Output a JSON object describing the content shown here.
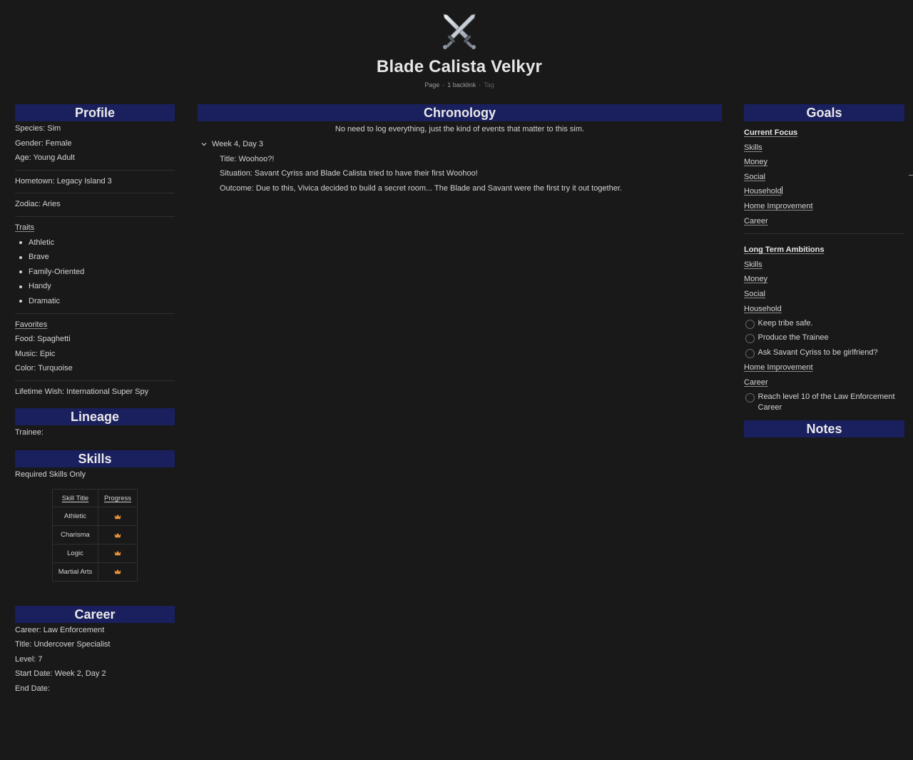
{
  "page": {
    "icon": "crossed-swords-icon",
    "title": "Blade Calista Velkyr",
    "meta": {
      "type": "Page",
      "backlinks": "1 backlink",
      "tag": "Tag"
    }
  },
  "profile": {
    "header": "Profile",
    "species": "Species: Sim",
    "gender": "Gender: Female",
    "age": "Age: Young Adult",
    "hometown": "Hometown: Legacy Island 3",
    "zodiac": "Zodiac: Aries",
    "traits_label": "Traits",
    "traits": [
      "Athletic",
      "Brave",
      "Family-Oriented",
      "Handy",
      "Dramatic"
    ],
    "favorites_label": "Favorites",
    "food": "Food: Spaghetti",
    "music": "Music: Epic",
    "color": "Color: Turquoise",
    "lifetime_wish": "Lifetime Wish: International Super Spy"
  },
  "lineage": {
    "header": "Lineage",
    "trainee": "Trainee:"
  },
  "skills": {
    "header": "Skills",
    "note": "Required Skills Only",
    "columns": [
      "Skill Title",
      "Progress"
    ],
    "rows": [
      {
        "skill": "Athletic",
        "progress_icon": "crown-icon"
      },
      {
        "skill": "Charisma",
        "progress_icon": "crown-icon"
      },
      {
        "skill": "Logic",
        "progress_icon": "crown-icon"
      },
      {
        "skill": "Martial Arts",
        "progress_icon": "crown-icon"
      }
    ],
    "crown_color": "#e8913a"
  },
  "career": {
    "header": "Career",
    "career": "Career: Law Enforcement",
    "title": "Title: Undercover Specialist",
    "level": "Level: 7",
    "start_date": "Start Date: Week 2, Day 2",
    "end_date": "End Date:"
  },
  "chronology": {
    "header": "Chronology",
    "description": "No need to log everything, just the kind of events that matter to this sim.",
    "entries": [
      {
        "toggle": "Week 4, Day 3",
        "title": "Title: Woohoo?!",
        "situation": "Situation: Savant Cyriss and Blade Calista tried to have their first Woohoo!",
        "outcome": "Outcome: Due to this, Vivica decided to build a secret room... The Blade and Savant were the first try it out together."
      }
    ]
  },
  "goals": {
    "header": "Goals",
    "current_focus": {
      "label": "Current Focus",
      "items": [
        "Skills",
        "Money",
        "Social",
        "Household",
        "Home Improvement",
        "Career"
      ]
    },
    "long_term": {
      "label": "Long Term Ambitions",
      "skills": "Skills",
      "money": "Money",
      "social": "Social",
      "household": "Household",
      "household_todos": [
        "Keep tribe safe.",
        "Produce the Trainee",
        "Ask Savant Cyriss to be girlfriend?"
      ],
      "home_improvement": "Home Improvement",
      "career": "Career",
      "career_todos": [
        "Reach level 10 of the Law Enforcement Career"
      ]
    }
  },
  "notes": {
    "header": "Notes"
  },
  "colors": {
    "background": "#191919",
    "header_bar": "#1a1f5e",
    "text": "#d4d4d4"
  }
}
